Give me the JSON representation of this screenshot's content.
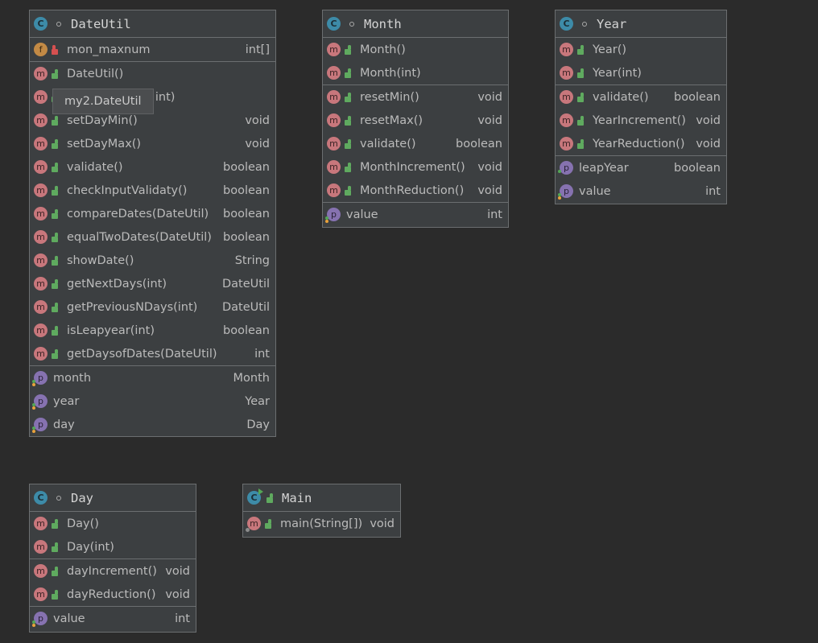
{
  "classes": {
    "dateutil": {
      "name": "DateUtil",
      "fields": [
        {
          "name": "mon_maxnum",
          "type": "int[]"
        }
      ],
      "methods": [
        {
          "name": "DateUtil()",
          "type": ""
        },
        {
          "name": "",
          "type": ""
        },
        {
          "name": "setDayMin()",
          "type": "void"
        },
        {
          "name": "setDayMax()",
          "type": "void"
        },
        {
          "name": "validate()",
          "type": "boolean"
        },
        {
          "name": "checkInputValidaty()",
          "type": "boolean"
        },
        {
          "name": "compareDates(DateUtil)",
          "type": "boolean"
        },
        {
          "name": "equalTwoDates(DateUtil)",
          "type": "boolean"
        },
        {
          "name": "showDate()",
          "type": "String"
        },
        {
          "name": "getNextDays(int)",
          "type": "DateUtil"
        },
        {
          "name": "getPreviousNDays(int)",
          "type": "DateUtil"
        },
        {
          "name": "isLeapyear(int)",
          "type": "boolean"
        },
        {
          "name": "getDaysofDates(DateUtil)",
          "type": "int"
        }
      ],
      "properties": [
        {
          "name": "month",
          "type": "Month"
        },
        {
          "name": "year",
          "type": "Year"
        },
        {
          "name": "day",
          "type": "Day"
        }
      ]
    },
    "month": {
      "name": "Month",
      "constructors": [
        {
          "name": "Month()",
          "type": ""
        },
        {
          "name": "Month(int)",
          "type": ""
        }
      ],
      "methods": [
        {
          "name": "resetMin()",
          "type": "void"
        },
        {
          "name": "resetMax()",
          "type": "void"
        },
        {
          "name": "validate()",
          "type": "boolean"
        },
        {
          "name": "MonthIncrement()",
          "type": "void"
        },
        {
          "name": "MonthReduction()",
          "type": "void"
        }
      ],
      "properties": [
        {
          "name": "value",
          "type": "int"
        }
      ]
    },
    "year": {
      "name": "Year",
      "constructors": [
        {
          "name": "Year()",
          "type": ""
        },
        {
          "name": "Year(int)",
          "type": ""
        }
      ],
      "methods": [
        {
          "name": "validate()",
          "type": "boolean"
        },
        {
          "name": "YearIncrement()",
          "type": "void"
        },
        {
          "name": "YearReduction()",
          "type": "void"
        }
      ],
      "properties": [
        {
          "name": "leapYear",
          "type": "boolean"
        },
        {
          "name": "value",
          "type": "int"
        }
      ]
    },
    "day": {
      "name": "Day",
      "constructors": [
        {
          "name": "Day()",
          "type": ""
        },
        {
          "name": "Day(int)",
          "type": ""
        }
      ],
      "methods": [
        {
          "name": "dayIncrement()",
          "type": "void"
        },
        {
          "name": "dayReduction()",
          "type": "void"
        }
      ],
      "properties": [
        {
          "name": "value",
          "type": "int"
        }
      ]
    },
    "main": {
      "name": "Main",
      "methods": [
        {
          "name": "main(String[])",
          "type": "void"
        }
      ]
    }
  },
  "tooltip": {
    "text": "my2.DateUtil",
    "hidden_suffix": "t, int)"
  },
  "icons": {
    "class": "C",
    "method": "m",
    "field": "f",
    "property": "p"
  },
  "colors": {
    "background": "#2b2b2b",
    "node": "#3c3f41",
    "class_icon": "#3d8ba8",
    "method_icon": "#c8777c",
    "field_icon": "#c38a45",
    "property_icon": "#8672b0",
    "public": "#5faa5f",
    "private": "#d65050"
  }
}
